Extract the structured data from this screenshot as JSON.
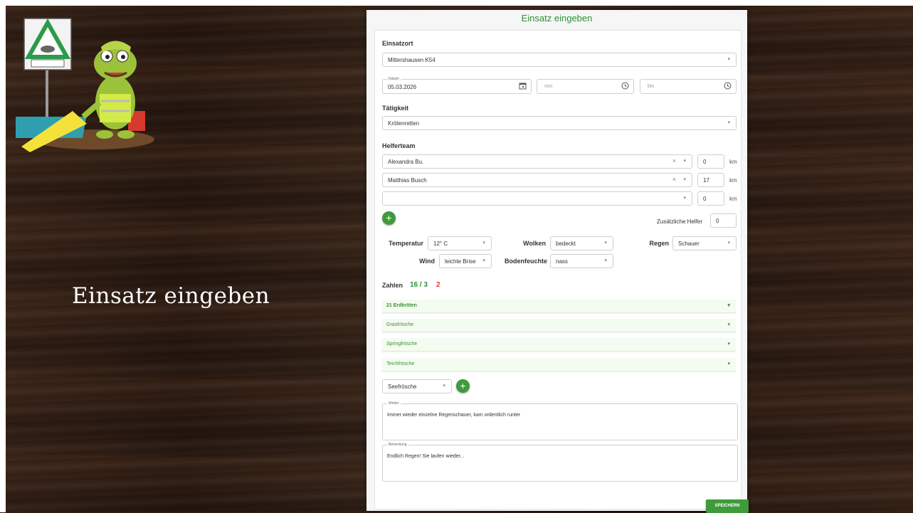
{
  "slide": {
    "title": "Einsatz eingeben"
  },
  "panel": {
    "title": "Einsatz eingeben"
  },
  "form": {
    "einsatzort": {
      "label": "Einsatzort",
      "value": "Mittershausen K54"
    },
    "datum": {
      "label": "Datum",
      "value": "05.03.2026"
    },
    "von": {
      "placeholder": "von"
    },
    "bis": {
      "placeholder": "bis"
    },
    "taetigkeit": {
      "label": "Tätigkeit",
      "value": "Krötenretten"
    },
    "helferteam": {
      "label": "Helferteam",
      "rows": [
        {
          "name": "Alexandra Bu.",
          "km": "0"
        },
        {
          "name": "Matthias Busch",
          "km": "17"
        },
        {
          "name": "",
          "km": "0"
        }
      ],
      "km_unit": "km"
    },
    "zusaetzliche_helfer": {
      "label": "Zusätzliche Helfer",
      "value": "0"
    },
    "wetter": {
      "temperatur": {
        "label": "Temperatur",
        "value": "12° C"
      },
      "wolken": {
        "label": "Wolken",
        "value": "bedeckt"
      },
      "regen": {
        "label": "Regen",
        "value": "Schauer"
      },
      "wind": {
        "label": "Wind",
        "value": "leichte Brise"
      },
      "bodenfeuchte": {
        "label": "Bodenfeuchte",
        "value": "nass"
      }
    },
    "zahlen": {
      "label": "Zahlen",
      "count": "16 / 3",
      "extra": "2"
    },
    "species": [
      {
        "label": "21 Erdkröten"
      },
      {
        "label": "Grasfrösche"
      },
      {
        "label": "Springfrösche"
      },
      {
        "label": "Teichfrösche"
      }
    ],
    "add_species": {
      "value": "Seefrösche"
    },
    "wetter_text": {
      "label": "Wetter",
      "value": "Immer wieder einzelne Regenschauer, kam ordentlich runter"
    },
    "bemerkung": {
      "label": "Bemerkung",
      "value": "Endlich Regen! Sie laufen wieder..."
    },
    "save_label": "SPEICHERN"
  },
  "colors": {
    "accent": "#3f9b3a",
    "zahlen_extra": "#e53935"
  }
}
